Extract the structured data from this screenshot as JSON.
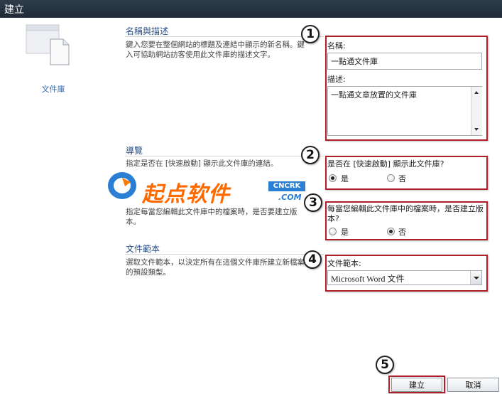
{
  "window": {
    "title": "建立"
  },
  "left_panel": {
    "label": "文件庫",
    "icon": "document-library-icon"
  },
  "sections": {
    "name_desc": {
      "header": "名稱與描述",
      "description": "鍵入您要在整個網站的標題及連結中顯示的新名稱。鍵入可協助網站訪客使用此文件庫的描述文字。",
      "name_label": "名稱:",
      "name_value": "一點通文件庫",
      "desc_label": "描述:",
      "desc_value": "一點通文章放置的文件庫"
    },
    "navigation": {
      "header": "導覽",
      "description": "指定是否在 [快速啟動] 顯示此文件庫的連結。",
      "question": "是否在 [快速啟動] 顯示此文件庫?",
      "yes": "是",
      "no": "否",
      "selected": "是"
    },
    "versioning": {
      "description": "指定每當您編輯此文件庫中的檔案時，是否要建立版本。",
      "question": "每當您編輯此文件庫中的檔案時，是否建立版本?",
      "yes": "是",
      "no": "否",
      "selected": "否"
    },
    "template": {
      "header": "文件範本",
      "description": "選取文件範本，以決定所有在這個文件庫所建立新檔案的預設類型。",
      "label": "文件範本:",
      "value": "Microsoft Word 文件"
    }
  },
  "markers": [
    "1",
    "2",
    "3",
    "4",
    "5"
  ],
  "buttons": {
    "create": "建立",
    "cancel": "取消"
  },
  "watermark": {
    "text": "起点软件",
    "badge_top": "CNCRK",
    "badge_bottom": ".COM"
  },
  "colors": {
    "red_box": "#b0202a",
    "header_blue": "#2a4f85",
    "title_bar": "#243240",
    "watermark": "#ff6a00"
  }
}
